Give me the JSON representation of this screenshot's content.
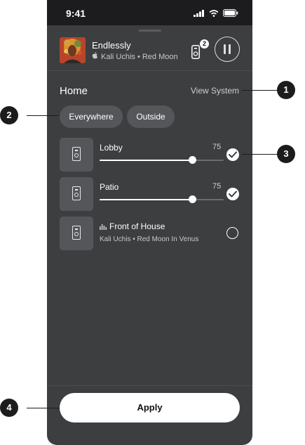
{
  "status_bar": {
    "time": "9:41"
  },
  "now_playing": {
    "title": "Endlessly",
    "subtitle": "Kali Uchis • Red Moon In Venus",
    "group_count": "2"
  },
  "home": {
    "title": "Home",
    "view_system_label": "View System"
  },
  "chips": [
    {
      "label": "Everywhere"
    },
    {
      "label": "Outside"
    }
  ],
  "rooms": [
    {
      "name": "Lobby",
      "volume": "75",
      "volume_level": 0.75,
      "selected": true
    },
    {
      "name": "Patio",
      "volume": "75",
      "volume_level": 0.75,
      "selected": true
    },
    {
      "name": "Front of House",
      "subtitle": "Kali Uchis • Red Moon In Venus",
      "selected": false
    }
  ],
  "apply_label": "Apply",
  "callouts": [
    "1",
    "2",
    "3",
    "4"
  ]
}
